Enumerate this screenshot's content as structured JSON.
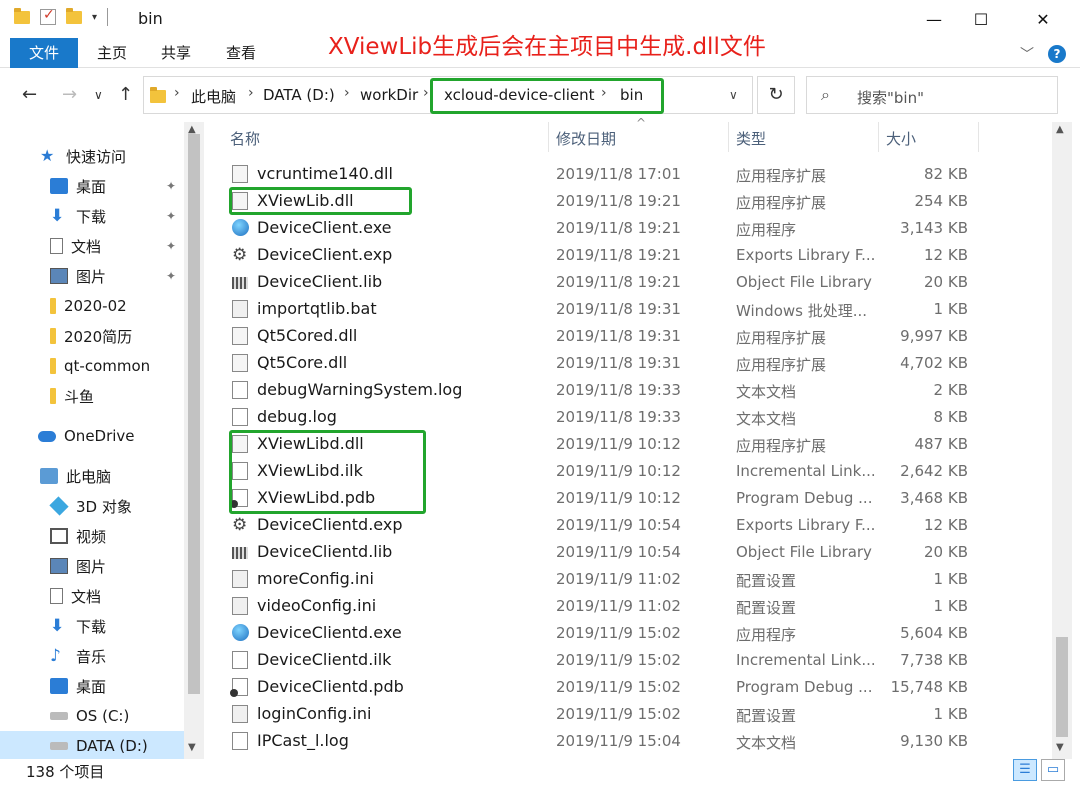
{
  "window": {
    "title": "bin",
    "minimize_glyph": "—",
    "maximize_glyph": "☐",
    "close_glyph": "✕"
  },
  "ribbon": {
    "tabs": [
      "文件",
      "主页",
      "共享",
      "查看"
    ],
    "expand_glyph": "﹀",
    "help_glyph": "?"
  },
  "annotation": "XViewLib生成后会在主项目中生成.dll文件",
  "navigation": {
    "back": "←",
    "forward": "→",
    "recent": "∨",
    "up": "↑",
    "refresh": "↻",
    "dropdown": "∨"
  },
  "address": {
    "path": [
      "此电脑",
      "DATA (D:)",
      "workDir",
      "xcloud-device-client",
      "bin"
    ],
    "separator": "›"
  },
  "search": {
    "placeholder": "搜索\"bin\"",
    "icon": "search-icon"
  },
  "sidebar": {
    "items": [
      {
        "label": "快速访问",
        "icon": "star-icon",
        "pinned": false
      },
      {
        "label": "桌面",
        "icon": "desktop-icon",
        "pinned": true
      },
      {
        "label": "下载",
        "icon": "download-icon",
        "pinned": true
      },
      {
        "label": "文档",
        "icon": "document-icon",
        "pinned": true
      },
      {
        "label": "图片",
        "icon": "picture-icon",
        "pinned": true
      },
      {
        "label": "2020-02",
        "icon": "folder-icon",
        "pinned": false
      },
      {
        "label": "2020简历",
        "icon": "folder-icon",
        "pinned": false
      },
      {
        "label": "qt-common",
        "icon": "folder-icon",
        "pinned": false
      },
      {
        "label": "斗鱼",
        "icon": "folder-icon",
        "pinned": false
      },
      {
        "label": "OneDrive",
        "icon": "cloud-icon",
        "pinned": false
      },
      {
        "label": "此电脑",
        "icon": "computer-icon",
        "pinned": false
      },
      {
        "label": "3D 对象",
        "icon": "3d-objects-icon",
        "pinned": false
      },
      {
        "label": "视频",
        "icon": "video-icon",
        "pinned": false
      },
      {
        "label": "图片",
        "icon": "picture-icon",
        "pinned": false
      },
      {
        "label": "文档",
        "icon": "document-icon",
        "pinned": false
      },
      {
        "label": "下载",
        "icon": "download-icon",
        "pinned": false
      },
      {
        "label": "音乐",
        "icon": "music-icon",
        "pinned": false
      },
      {
        "label": "桌面",
        "icon": "desktop-icon",
        "pinned": false
      },
      {
        "label": "OS (C:)",
        "icon": "drive-icon",
        "pinned": false
      },
      {
        "label": "DATA (D:)",
        "icon": "drive-icon",
        "pinned": false
      }
    ],
    "selected": "DATA (D:)",
    "pin_glyph": "📌"
  },
  "columns": {
    "name": "名称",
    "date": "修改日期",
    "type": "类型",
    "size": "大小",
    "sort_glyph": "^"
  },
  "files": [
    {
      "name": "vcruntime140.dll",
      "date": "2019/11/8 17:01",
      "type": "应用程序扩展",
      "size": "82 KB",
      "icon": "dll-icon"
    },
    {
      "name": "XViewLib.dll",
      "date": "2019/11/8 19:21",
      "type": "应用程序扩展",
      "size": "254 KB",
      "icon": "dll-icon"
    },
    {
      "name": "DeviceClient.exe",
      "date": "2019/11/8 19:21",
      "type": "应用程序",
      "size": "3,143 KB",
      "icon": "exe-icon"
    },
    {
      "name": "DeviceClient.exp",
      "date": "2019/11/8 19:21",
      "type": "Exports Library F...",
      "size": "12 KB",
      "icon": "gear-icon"
    },
    {
      "name": "DeviceClient.lib",
      "date": "2019/11/8 19:21",
      "type": "Object File Library",
      "size": "20 KB",
      "icon": "library-icon"
    },
    {
      "name": "importqtlib.bat",
      "date": "2019/11/8 19:31",
      "type": "Windows 批处理...",
      "size": "1 KB",
      "icon": "batch-icon"
    },
    {
      "name": "Qt5Cored.dll",
      "date": "2019/11/8 19:31",
      "type": "应用程序扩展",
      "size": "9,997 KB",
      "icon": "dll-icon"
    },
    {
      "name": "Qt5Core.dll",
      "date": "2019/11/8 19:31",
      "type": "应用程序扩展",
      "size": "4,702 KB",
      "icon": "dll-icon"
    },
    {
      "name": "debugWarningSystem.log",
      "date": "2019/11/8 19:33",
      "type": "文本文档",
      "size": "2 KB",
      "icon": "text-file-icon"
    },
    {
      "name": "debug.log",
      "date": "2019/11/8 19:33",
      "type": "文本文档",
      "size": "8 KB",
      "icon": "text-file-icon"
    },
    {
      "name": "XViewLibd.dll",
      "date": "2019/11/9 10:12",
      "type": "应用程序扩展",
      "size": "487 KB",
      "icon": "dll-icon"
    },
    {
      "name": "XViewLibd.ilk",
      "date": "2019/11/9 10:12",
      "type": "Incremental Link...",
      "size": "2,642 KB",
      "icon": "file-icon"
    },
    {
      "name": "XViewLibd.pdb",
      "date": "2019/11/9 10:12",
      "type": "Program Debug ...",
      "size": "3,468 KB",
      "icon": "pdb-icon"
    },
    {
      "name": "DeviceClientd.exp",
      "date": "2019/11/9 10:54",
      "type": "Exports Library F...",
      "size": "12 KB",
      "icon": "gear-icon"
    },
    {
      "name": "DeviceClientd.lib",
      "date": "2019/11/9 10:54",
      "type": "Object File Library",
      "size": "20 KB",
      "icon": "library-icon"
    },
    {
      "name": "moreConfig.ini",
      "date": "2019/11/9 11:02",
      "type": "配置设置",
      "size": "1 KB",
      "icon": "config-icon"
    },
    {
      "name": "videoConfig.ini",
      "date": "2019/11/9 11:02",
      "type": "配置设置",
      "size": "1 KB",
      "icon": "config-icon"
    },
    {
      "name": "DeviceClientd.exe",
      "date": "2019/11/9 15:02",
      "type": "应用程序",
      "size": "5,604 KB",
      "icon": "exe-icon"
    },
    {
      "name": "DeviceClientd.ilk",
      "date": "2019/11/9 15:02",
      "type": "Incremental Link...",
      "size": "7,738 KB",
      "icon": "file-icon"
    },
    {
      "name": "DeviceClientd.pdb",
      "date": "2019/11/9 15:02",
      "type": "Program Debug ...",
      "size": "15,748 KB",
      "icon": "pdb-icon"
    },
    {
      "name": "loginConfig.ini",
      "date": "2019/11/9 15:02",
      "type": "配置设置",
      "size": "1 KB",
      "icon": "config-icon"
    },
    {
      "name": "IPCast_l.log",
      "date": "2019/11/9 15:04",
      "type": "文本文档",
      "size": "9,130 KB",
      "icon": "text-file-icon"
    }
  ],
  "highlight_color": "#22a52d",
  "annotation_color": "#e8211b",
  "accent_color": "#1979ca",
  "status": {
    "item_count": "138 个项目"
  }
}
